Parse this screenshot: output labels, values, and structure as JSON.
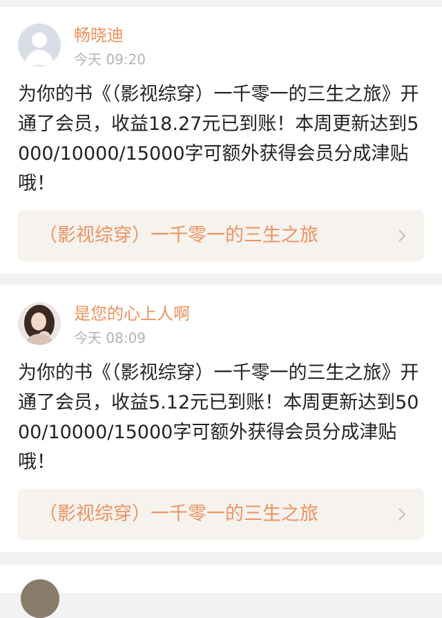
{
  "notifications": [
    {
      "user_name": "畅晓迪",
      "time": "今天 09:20",
      "message": "为你的书《（影视综穿）一千零一的三生之旅》开通了会员，收益18.27元已到账！本周更新达到5000/10000/15000字可额外获得会员分成津贴哦！",
      "book_title": "（影视综穿）一千零一的三生之旅",
      "avatar_icon": "default-user-icon",
      "link_icon": "chevron-right-icon"
    },
    {
      "user_name": "是您的心上人啊",
      "time": "今天 08:09",
      "message": "为你的书《（影视综穿）一千零一的三生之旅》开通了会员，收益5.12元已到账！本周更新达到5000/10000/15000字可额外获得会员分成津贴哦！",
      "book_title": "（影视综穿）一千零一的三生之旅",
      "avatar_icon": "user-photo",
      "link_icon": "chevron-right-icon"
    }
  ],
  "colors": {
    "name": "#f0905a",
    "time": "#b2b2b2",
    "text": "#222222",
    "link_bg": "#f6f3ee",
    "link_text": "#ee9260",
    "page_bg": "#f2f2f2"
  }
}
